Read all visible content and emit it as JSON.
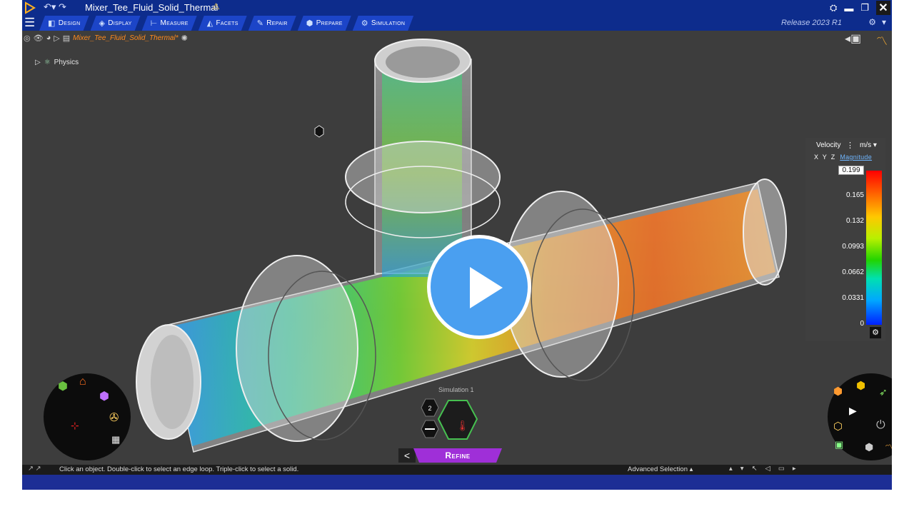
{
  "titlebar": {
    "title": "Mixer_Tee_Fluid_Solid_Thermal",
    "warning_glyph": "⚠",
    "logo": "discovery-logo-icon",
    "minimize": "▬",
    "restore": "❐",
    "close": "✕"
  },
  "ribbon": {
    "menu": "☰",
    "tabs": [
      {
        "label": "Design",
        "icon": "◧"
      },
      {
        "label": "Display",
        "icon": "◈"
      },
      {
        "label": "Measure",
        "icon": "⊢"
      },
      {
        "label": "Facets",
        "icon": "◭"
      },
      {
        "label": "Repair",
        "icon": "✎"
      },
      {
        "label": "Prepare",
        "icon": "⬢"
      },
      {
        "label": "Simulation",
        "icon": "⚙"
      }
    ],
    "release": "Release 2023 R1",
    "accent": "#0d2c8c",
    "tab_color": "#1c45c8"
  },
  "breadcrumb": {
    "document": "Mixer_Tee_Fluid_Solid_Thermal*"
  },
  "tree": {
    "physics": "Physics"
  },
  "legend": {
    "quantity": "Velocity",
    "unit": "m/s",
    "axes": [
      "X",
      "Y",
      "Z"
    ],
    "component": "Magnitude",
    "ticks": [
      "0.199",
      "0.165",
      "0.132",
      "0.0993",
      "0.0662",
      "0.0331",
      "0"
    ],
    "max_value": 0.199,
    "min_value": 0
  },
  "simulation": {
    "label": "Simulation 1",
    "count": "2",
    "stage": "Refine",
    "back": "<"
  },
  "status": {
    "message": "Click an object. Double-click to select an edge loop. Triple-click to select a solid.",
    "advanced": "Advanced Selection"
  },
  "play_button": {
    "color": "#4a9ff0"
  }
}
